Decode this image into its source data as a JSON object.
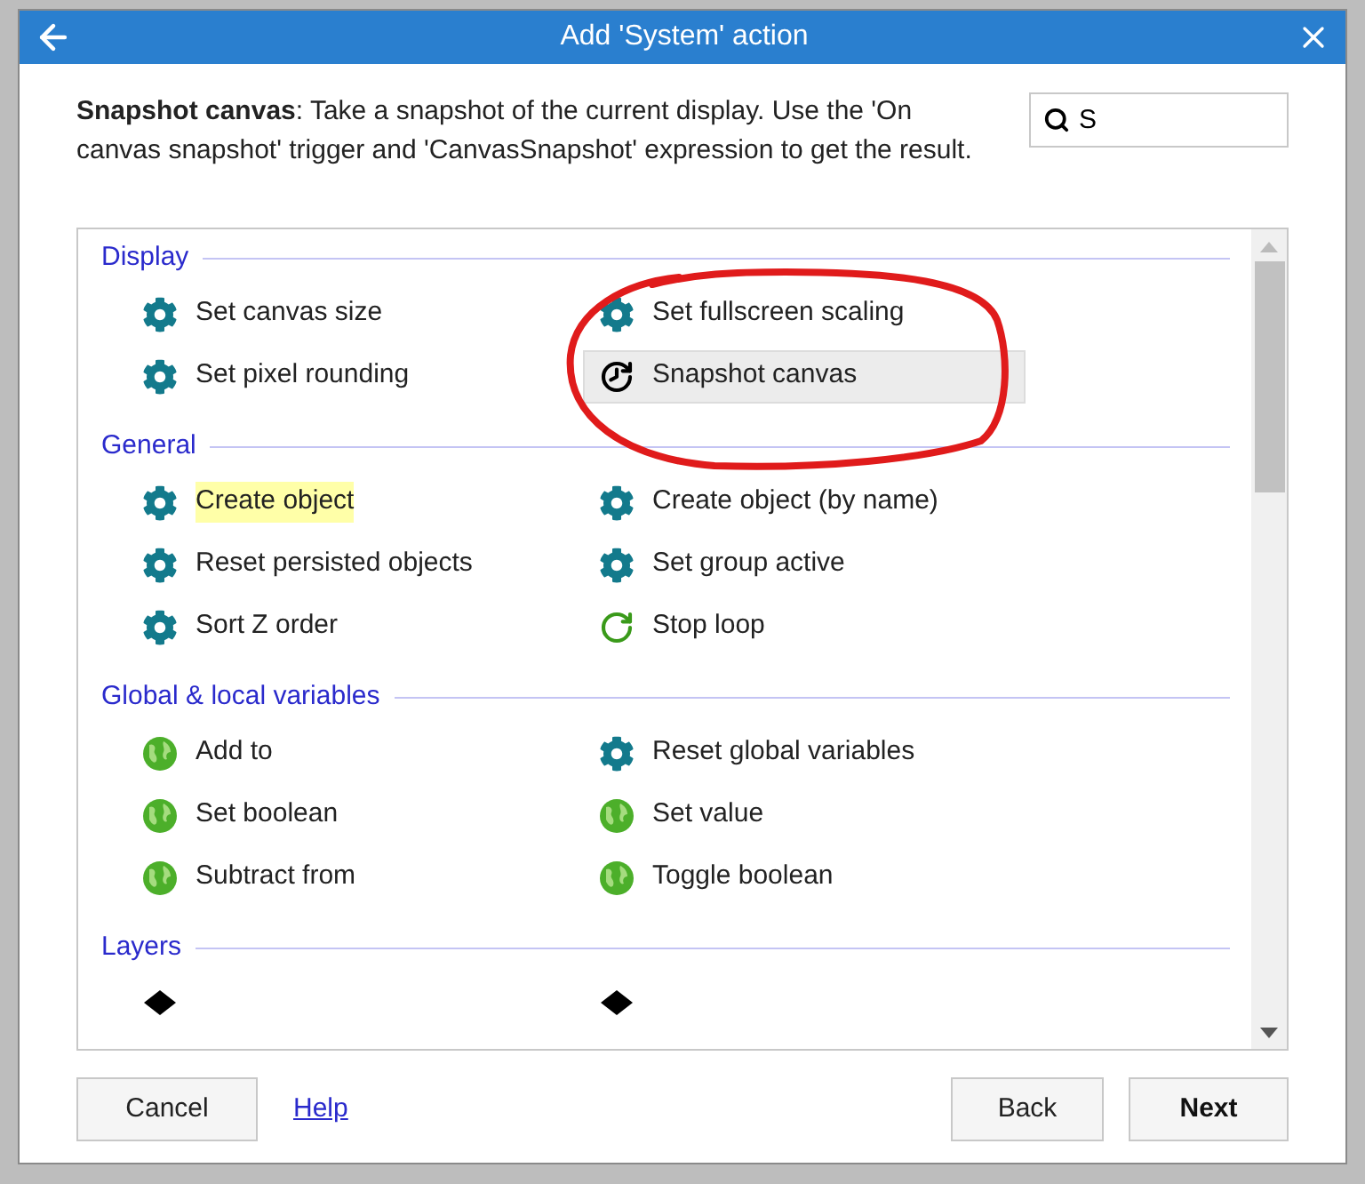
{
  "window": {
    "title": "Add 'System' action"
  },
  "description": "**Snapshot canvas**: Take a snapshot of the current display. Use the 'On canvas snapshot' trigger and 'CanvasSnapshot' expression to get the result.",
  "search": {
    "value": "S"
  },
  "sections": [
    {
      "title": "Display",
      "items": [
        {
          "label": "Set canvas size",
          "kind": "gear",
          "selected": false,
          "highlighted": false
        },
        {
          "label": "Set fullscreen scaling",
          "kind": "gear",
          "selected": false,
          "highlighted": false
        },
        {
          "label": "Set pixel rounding",
          "kind": "gear",
          "selected": false,
          "highlighted": false
        },
        {
          "label": "Snapshot canvas",
          "kind": "snapshot",
          "selected": true,
          "highlighted": false
        }
      ]
    },
    {
      "title": "General",
      "items": [
        {
          "label": "Create object",
          "kind": "gear",
          "selected": false,
          "highlighted": true
        },
        {
          "label": "Create object (by name)",
          "kind": "gear",
          "selected": false,
          "highlighted": false
        },
        {
          "label": "Reset persisted objects",
          "kind": "gear",
          "selected": false,
          "highlighted": false
        },
        {
          "label": "Set group active",
          "kind": "gear",
          "selected": false,
          "highlighted": false
        },
        {
          "label": "Sort Z order",
          "kind": "gear",
          "selected": false,
          "highlighted": false
        },
        {
          "label": "Stop loop",
          "kind": "loop",
          "selected": false,
          "highlighted": false
        }
      ]
    },
    {
      "title": "Global & local variables",
      "items": [
        {
          "label": "Add to",
          "kind": "globe",
          "selected": false,
          "highlighted": false
        },
        {
          "label": "Reset global variables",
          "kind": "gear",
          "selected": false,
          "highlighted": false
        },
        {
          "label": "Set boolean",
          "kind": "globe",
          "selected": false,
          "highlighted": false
        },
        {
          "label": "Set value",
          "kind": "globe",
          "selected": false,
          "highlighted": false
        },
        {
          "label": "Subtract from",
          "kind": "globe",
          "selected": false,
          "highlighted": false
        },
        {
          "label": "Toggle boolean",
          "kind": "globe",
          "selected": false,
          "highlighted": false
        }
      ]
    },
    {
      "title": "Layers",
      "items": [
        {
          "kind": "layer",
          "selected": false
        },
        {
          "kind": "layer",
          "selected": false
        }
      ]
    }
  ],
  "buttons": {
    "cancel": "Cancel",
    "help": "Help",
    "back": "Back",
    "next": "Next"
  }
}
